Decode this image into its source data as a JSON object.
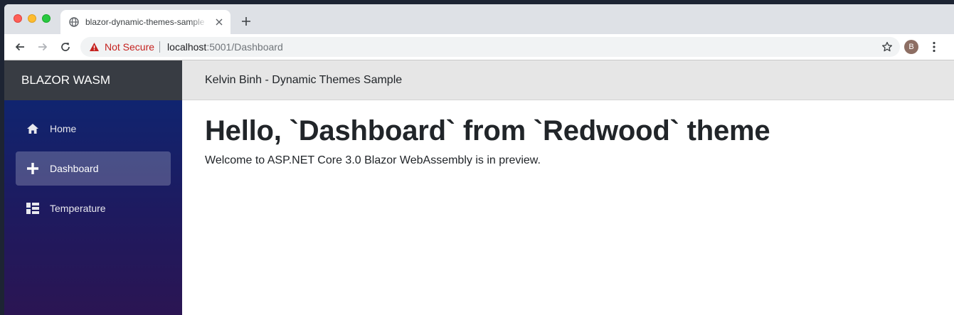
{
  "browser": {
    "tab_title": "blazor-dynamic-themes-sample",
    "security_text": "Not Secure",
    "url_host": "localhost",
    "url_path": ":5001/Dashboard",
    "profile_initial": "B"
  },
  "sidebar": {
    "brand": "BLAZOR WASM",
    "items": [
      {
        "label": "Home",
        "icon": "home-icon",
        "active": false
      },
      {
        "label": "Dashboard",
        "icon": "plus-icon",
        "active": true
      },
      {
        "label": "Temperature",
        "icon": "view-quilt-icon",
        "active": false
      }
    ]
  },
  "topbar": {
    "title": "Kelvin Binh - Dynamic Themes Sample"
  },
  "main": {
    "heading": "Hello, `Dashboard` from `Redwood` theme",
    "welcome": "Welcome to ASP.NET Core 3.0 Blazor WebAssembly is in preview."
  },
  "colors": {
    "sidebar_top": "#0b2875",
    "sidebar_bottom": "#2b1553",
    "brand_bar": "#383c43",
    "topbar": "#e6e6e6",
    "warning": "#c5221f"
  }
}
